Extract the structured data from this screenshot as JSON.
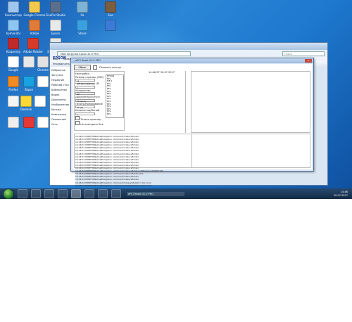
{
  "desktop": {
    "icons": [
      {
        "label": "Компьютер",
        "color": "#9fc6ef"
      },
      {
        "label": "Google Chrome",
        "color": "#f2c94c"
      },
      {
        "label": "FinePix Studio",
        "color": "#5a6f8c"
      },
      {
        "label": "Sa",
        "color": "#7fb3d5"
      },
      {
        "label": "Exe",
        "color": "#7b5d3f"
      },
      {
        "label": "hpmonitor",
        "color": "#8cc4f2"
      },
      {
        "label": "Adobe",
        "color": "#e07b39"
      },
      {
        "label": "Epson",
        "color": "#e9e9e9"
      },
      {
        "label": "Share",
        "color": "#3aa0e0"
      },
      {
        "label": "",
        "color": "#3a7bd5"
      },
      {
        "label": "Kaspersky",
        "color": "#c12a2a"
      },
      {
        "label": "Adobe Reader",
        "color": "#d83a2a"
      },
      {
        "label": "Epson Scan",
        "color": "#e6e6e6"
      },
      {
        "label": "Google",
        "color": "#ffffff"
      },
      {
        "label": "",
        "color": "#e8e8e8"
      },
      {
        "label": "Chrome",
        "color": "#e2e2e2"
      },
      {
        "label": "Firefox",
        "color": "#f08a24"
      },
      {
        "label": "Skype",
        "color": "#1aa1e0"
      },
      {
        "label": "",
        "color": "#ffffff"
      },
      {
        "label": "",
        "color": "#f4f4f4"
      },
      {
        "label": "Daemon",
        "color": "#fdd835"
      },
      {
        "label": "",
        "color": "#ffffff"
      },
      {
        "label": "",
        "color": "#eeeeee"
      },
      {
        "label": "",
        "color": "#e53935"
      },
      {
        "label": "",
        "color": "#ffffff"
      }
    ]
  },
  "explorer": {
    "path": "Мой Загрузки Epson 41.0 PRO",
    "search": "Поиск",
    "menu": [
      "Файл",
      "Правка",
      "Вид",
      "Сервис",
      "Справка"
    ],
    "toolbar": [
      "Упорядочить",
      "Открыть",
      "Записать на оптический диск"
    ],
    "logo": "EPSON",
    "nav": [
      "Избранное",
      "Загрузки",
      "Недавние",
      "Рабочий стол",
      "Библиотеки",
      "Видео",
      "Документы",
      "Изображения",
      "Музыка",
      "Компьютер",
      "Локальный",
      "Сеть"
    ]
  },
  "dialog": {
    "title": "ePCi Reset 41.0 PRO",
    "close": "x",
    "reset_button": "Сброс",
    "check_label": "Показать всегда",
    "section_label": "Настройки",
    "fields": [
      {
        "label": "Размер страниц (ПУС)",
        "value": "ss-Автоматически"
      },
      {
        "label": "Номер страниц (Р)",
        "value": "1"
      },
      {
        "label": "Количество",
        "value": "40"
      },
      {
        "label": "Документы/Услуги",
        "value": "75 (кол)"
      },
      {
        "label": "Печать/Копирование",
        "value": "25 (0)"
      },
      {
        "label": "Количество/Копий",
        "value": "1"
      }
    ],
    "models": [
      "EPSON",
      "EPL",
      "ME-1",
      "EPL",
      "EPL",
      "EPL",
      "EPL",
      "EPL",
      "EPL",
      "EPL",
      "EPL",
      "EPL",
      "EPL",
      "EPL",
      "EPL",
      "EPL"
    ],
    "bottom_checks": [
      "Только принтер",
      "Не повторять"
    ],
    "bottom_value": "Все",
    "timestamp": "14:46:37 30.07.2017",
    "log": [
      "14:46:31 EXEPTIONshowException command=reduceFolder",
      "14:46:31 EXEPTIONshowException command=reduceFolder",
      "14:46:31 EXEPTIONshowException command=reduceFolder",
      "14:46:31 EXEPTIONshowException command=reduceFolder",
      "14:46:31 EXEPTIONshowException command=reduceFolder",
      "14:46:31 EXEPTIONshowException command=reduceFolder",
      "14:46:31 EXEPTIONshowException command=reduceFolder",
      "14:46:31 EXEPTIONshowException command=reduceFolder",
      "14:46:31 EXEPTIONshowException command=reduceFolder",
      "14:46:32 EXEPTIONshowException command=reduceFolder",
      "14:46:32 EXEPTIONshowException command=reduceFolder",
      "14:46:32 EXEPTIONshowException command=reduceFolder",
      "14:46:32 EXEPTIONshowException command=reduceFolder rafWorker=349847167",
      "14:46:32 EXEPTIONshowException command=reduceFolder wrk",
      "14:46:32 EXEPTIONshowException command=reduceFolder",
      "14:46:32 EXEPTIONshowException command=reduceFolder",
      "14:46:32 EXEPTIONshowException command=Queryisfolder=char=null",
      "14:46:32 EXEPTIONshowException command=Queryisfolder=char=null"
    ]
  },
  "taskbar": {
    "items": [
      "ie-icon",
      "explorer-icon",
      "firefox-icon",
      "media-icon",
      "terminal-icon",
      "app-icon",
      "app-icon",
      "refresh-icon"
    ],
    "active_text": "ePCi Reset 41.0 PRO",
    "time": "14:46",
    "date": "30.07.2017"
  }
}
